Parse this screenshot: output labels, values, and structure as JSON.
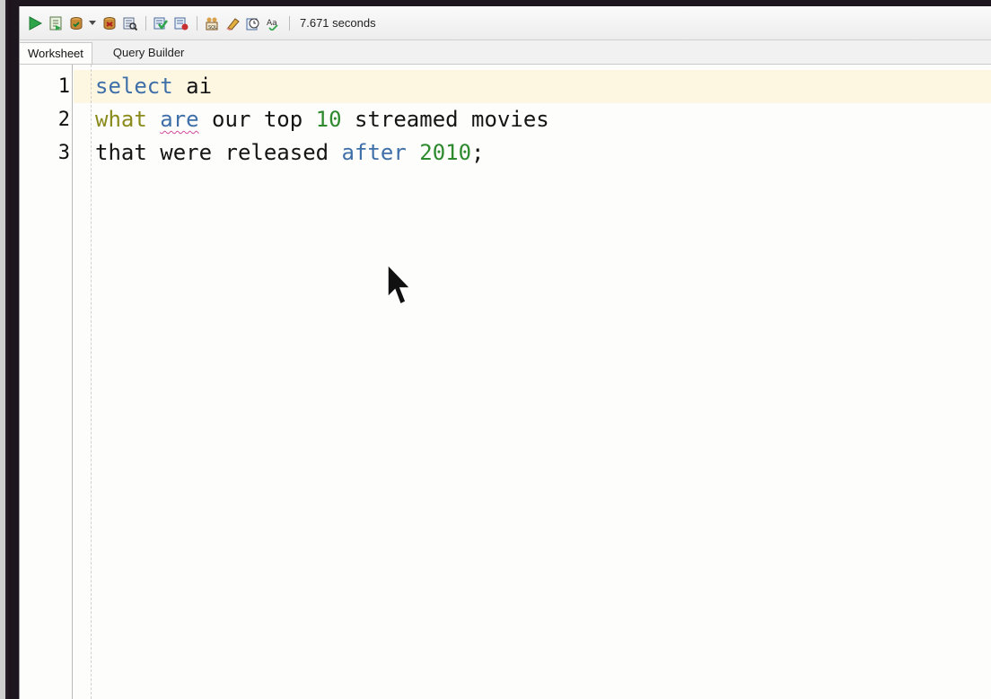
{
  "toolbar": {
    "buttons": [
      {
        "name": "run-statement",
        "icon": "play-icon"
      },
      {
        "name": "run-script",
        "icon": "script-icon"
      },
      {
        "name": "commit",
        "icon": "commit-icon"
      },
      {
        "name": "rollback",
        "icon": "rollback-icon"
      },
      {
        "name": "explain-plan",
        "icon": "explain-plan-icon"
      },
      {
        "name": "autotrace",
        "icon": "autotrace-icon"
      },
      {
        "name": "sql-tuning",
        "icon": "tuning-icon"
      },
      {
        "name": "clear",
        "icon": "eraser-icon"
      },
      {
        "name": "history",
        "icon": "history-icon"
      },
      {
        "name": "format",
        "icon": "format-icon"
      }
    ],
    "timing": "7.671 seconds"
  },
  "tabs": [
    {
      "label": "Worksheet",
      "active": true
    },
    {
      "label": "Query Builder",
      "active": false
    }
  ],
  "editor": {
    "line_numbers": [
      "1",
      "2",
      "3"
    ],
    "lines": [
      {
        "tokens": [
          {
            "t": "select",
            "c": "kw-blue"
          },
          {
            "t": " ai",
            "c": ""
          }
        ]
      },
      {
        "tokens": [
          {
            "t": "what",
            "c": "kw-olive"
          },
          {
            "t": " ",
            "c": ""
          },
          {
            "t": "are",
            "c": "kw-blue squiggle"
          },
          {
            "t": " our top ",
            "c": ""
          },
          {
            "t": "10",
            "c": "num-green"
          },
          {
            "t": " streamed movies",
            "c": ""
          }
        ]
      },
      {
        "tokens": [
          {
            "t": "that were released ",
            "c": ""
          },
          {
            "t": "after",
            "c": "kw-blue"
          },
          {
            "t": " ",
            "c": ""
          },
          {
            "t": "2010",
            "c": "num-green"
          },
          {
            "t": ";",
            "c": ""
          }
        ]
      }
    ]
  },
  "colors": {
    "keyword": "#3f6fa8",
    "keyword_alt": "#8b8b1c",
    "number": "#2e8a2e",
    "current_line": "#fdf7e1"
  }
}
